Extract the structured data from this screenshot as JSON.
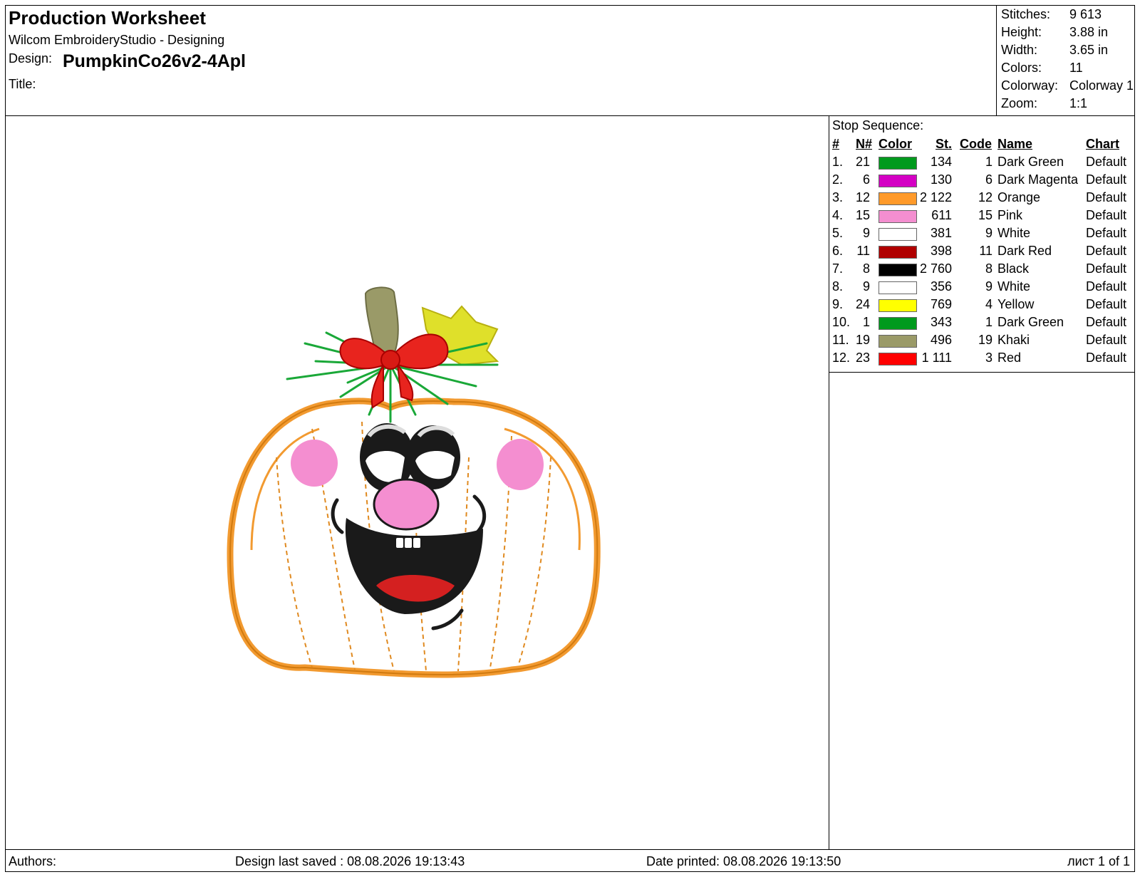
{
  "header": {
    "title": "Production Worksheet",
    "app": "Wilcom EmbroideryStudio - Designing",
    "design_label": "Design:",
    "design_name": "PumpkinCo26v2-4Apl",
    "title_label": "Title:"
  },
  "info": [
    {
      "label": "Stitches:",
      "value": "9 613"
    },
    {
      "label": "Height:",
      "value": "3.88 in"
    },
    {
      "label": "Width:",
      "value": "3.65 in"
    },
    {
      "label": "Colors:",
      "value": "11"
    },
    {
      "label": "Colorway:",
      "value": "Colorway 1"
    },
    {
      "label": "Zoom:",
      "value": "1:1"
    }
  ],
  "stops": {
    "title": "Stop Sequence:",
    "headers": {
      "num": "#",
      "n": "N#",
      "color": "Color",
      "st": "St.",
      "code": "Code",
      "name": "Name",
      "chart": "Chart"
    },
    "rows": [
      {
        "num": "1.",
        "n": "21",
        "color": "#009a1d",
        "st": "134",
        "code": "1",
        "name": "Dark Green",
        "chart": "Default"
      },
      {
        "num": "2.",
        "n": "6",
        "color": "#d400c4",
        "st": "130",
        "code": "6",
        "name": "Dark Magenta",
        "chart": "Default"
      },
      {
        "num": "3.",
        "n": "12",
        "color": "#ff9a2a",
        "st": "2 122",
        "code": "12",
        "name": "Orange",
        "chart": "Default"
      },
      {
        "num": "4.",
        "n": "15",
        "color": "#f48ed0",
        "st": "611",
        "code": "15",
        "name": "Pink",
        "chart": "Default"
      },
      {
        "num": "5.",
        "n": "9",
        "color": "#ffffff",
        "st": "381",
        "code": "9",
        "name": "White",
        "chart": "Default"
      },
      {
        "num": "6.",
        "n": "11",
        "color": "#b00000",
        "st": "398",
        "code": "11",
        "name": "Dark Red",
        "chart": "Default"
      },
      {
        "num": "7.",
        "n": "8",
        "color": "#000000",
        "st": "2 760",
        "code": "8",
        "name": "Black",
        "chart": "Default"
      },
      {
        "num": "8.",
        "n": "9",
        "color": "#ffffff",
        "st": "356",
        "code": "9",
        "name": "White",
        "chart": "Default"
      },
      {
        "num": "9.",
        "n": "24",
        "color": "#ffff00",
        "st": "769",
        "code": "4",
        "name": "Yellow",
        "chart": "Default"
      },
      {
        "num": "10.",
        "n": "1",
        "color": "#009a1d",
        "st": "343",
        "code": "1",
        "name": "Dark Green",
        "chart": "Default"
      },
      {
        "num": "11.",
        "n": "19",
        "color": "#9a9a68",
        "st": "496",
        "code": "19",
        "name": "Khaki",
        "chart": "Default"
      },
      {
        "num": "12.",
        "n": "23",
        "color": "#ff0000",
        "st": "1 111",
        "code": "3",
        "name": "Red",
        "chart": "Default"
      }
    ]
  },
  "footer": {
    "authors": "Authors:",
    "last_saved": "Design last saved : 08.08.2026 19:13:43",
    "printed": "Date printed: 08.08.2026 19:13:50",
    "page": "лист 1 of 1"
  }
}
